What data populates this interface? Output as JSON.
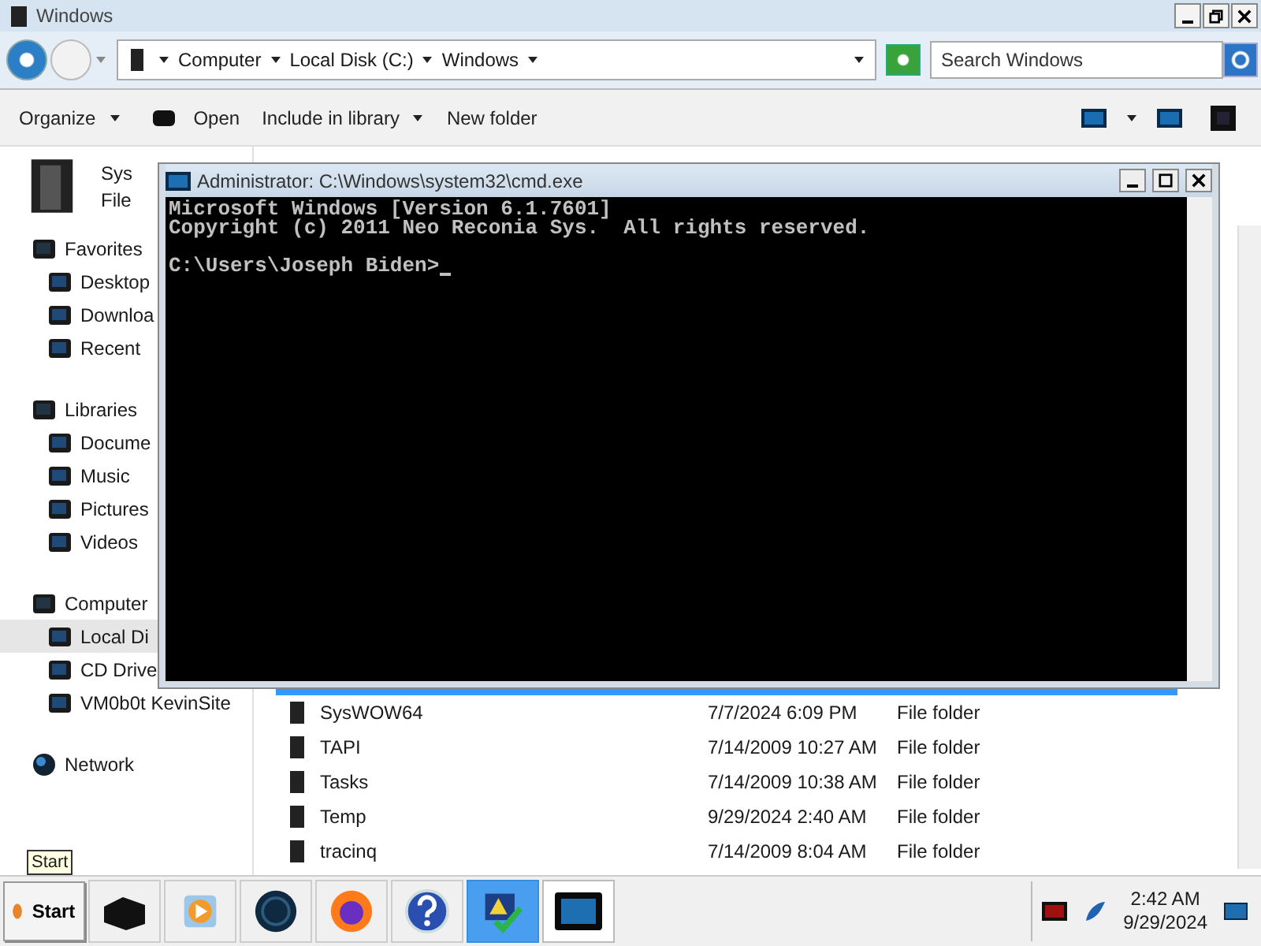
{
  "explorer": {
    "title": "Windows",
    "breadcrumb": [
      "Computer",
      "Local Disk (C:)",
      "Windows"
    ],
    "search": {
      "placeholder": "Search Windows"
    },
    "toolbar": [
      {
        "label": "Organize",
        "dropdown": true
      },
      {
        "label": "Open",
        "dropdown": false
      },
      {
        "label": "Include in library",
        "dropdown": true
      },
      {
        "label": "New folder",
        "dropdown": false
      }
    ],
    "details": {
      "name": "Sys",
      "type": "File"
    },
    "nav": [
      {
        "label": "Favorites",
        "selected": false,
        "children": [
          {
            "label": "Desktop",
            "selected": false
          },
          {
            "label": "Downloa",
            "selected": false
          },
          {
            "label": "Recent",
            "selected": false
          }
        ]
      },
      {
        "label": "Libraries",
        "selected": false,
        "children": [
          {
            "label": "Docume",
            "selected": false
          },
          {
            "label": "Music",
            "selected": false
          },
          {
            "label": "Pictures",
            "selected": false
          },
          {
            "label": "Videos",
            "selected": false
          }
        ]
      },
      {
        "label": "Computer",
        "selected": false,
        "children": [
          {
            "label": "Local Di",
            "selected": true
          },
          {
            "label": "CD Drive",
            "selected": false
          },
          {
            "label": "VM0b0t KevinSite",
            "selected": false
          }
        ]
      },
      {
        "label": "Network",
        "selected": false
      }
    ],
    "files": [
      {
        "selected": true
      },
      {
        "name": "SysWOW64",
        "date": "7/7/2024 6:09 PM",
        "type": "File folder",
        "selected": false
      },
      {
        "name": "TAPI",
        "date": "7/14/2009 10:27 AM",
        "type": "File folder",
        "selected": false
      },
      {
        "name": "Tasks",
        "date": "7/14/2009 10:38 AM",
        "type": "File folder",
        "selected": false
      },
      {
        "name": "Temp",
        "date": "9/29/2024 2:40 AM",
        "type": "File folder",
        "selected": false
      },
      {
        "name": "tracinq",
        "date": "7/14/2009 8:04 AM",
        "type": "File folder",
        "selected": false
      }
    ]
  },
  "cmd": {
    "title": "Administrator: C:\\Windows\\system32\\cmd.exe",
    "output": [
      "Microsoft Windows [Version 6.1.7601]",
      "Copyright (c) 2011 Neo Reconia Sys.  All rights reserved."
    ],
    "prompt": "C:\\Users\\Joseph Biden>"
  },
  "taskbar": {
    "start": "Start",
    "tooltip": "Start",
    "apps": [
      {
        "pressed": false,
        "selected": false
      },
      {
        "pressed": false,
        "selected": false
      },
      {
        "pressed": false,
        "selected": false
      },
      {
        "pressed": false,
        "selected": false
      },
      {
        "pressed": false,
        "selected": false
      },
      {
        "pressed": true,
        "selected": false
      },
      {
        "pressed": false,
        "selected": true
      }
    ],
    "clock": {
      "time": "2:42 AM",
      "date": "9/29/2024"
    }
  }
}
